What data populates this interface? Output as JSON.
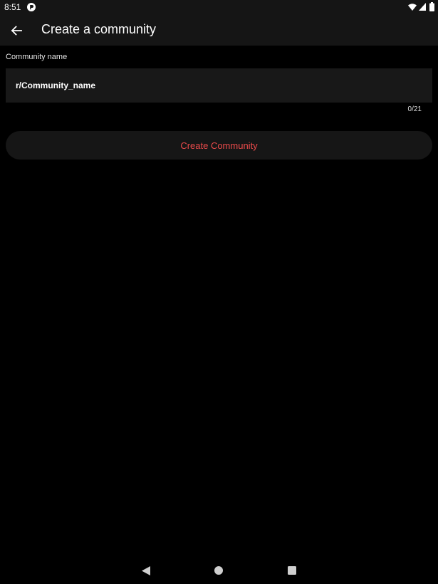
{
  "status_bar": {
    "time": "8:51",
    "icons": [
      "notification-icon",
      "wifi-icon",
      "signal-icon",
      "battery-icon"
    ]
  },
  "app_bar": {
    "title": "Create a community",
    "back_icon": "arrow-back-icon"
  },
  "form": {
    "label": "Community name",
    "input_value": "",
    "input_placeholder": "r/Community_name",
    "counter": "0/21"
  },
  "actions": {
    "create_label": "Create Community"
  },
  "nav_bar": {
    "icons": [
      "nav-back-icon",
      "nav-home-icon",
      "nav-recents-icon"
    ]
  },
  "colors": {
    "background": "#000000",
    "bar": "#151515",
    "field": "#181818",
    "accent": "#ea4a4a"
  }
}
